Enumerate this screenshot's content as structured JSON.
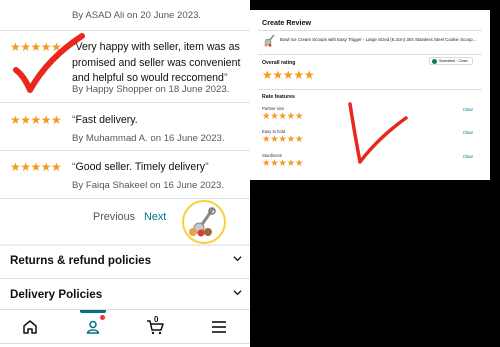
{
  "left": {
    "top_byline": "By ASAD Ali on 20 June 2023.",
    "reviews": [
      {
        "stars": "★★★★★",
        "text": "Very happy with seller, item was as promised and seller was convenient and helpful so would reccomend",
        "byline": "By Happy Shopper on 18 June 2023."
      },
      {
        "stars": "★★★★★",
        "text": "Fast delivery.",
        "byline": "By Muhammad A. on 16 June 2023."
      },
      {
        "stars": "★★★★★",
        "text": "Good seller. Timely delivery",
        "byline": "By Faiqa Shakeel on 16 June 2023."
      }
    ],
    "quote_open": "“",
    "quote_close": "”",
    "pager": {
      "previous": "Previous",
      "next": "Next"
    },
    "sections": [
      {
        "label": "Returns & refund policies"
      },
      {
        "label": "Delivery Policies"
      }
    ],
    "tabs": {
      "home_icon": "home-icon",
      "account_icon": "account-icon",
      "cart_icon": "cart-icon",
      "cart_count": "0",
      "menu_icon": "menu-icon"
    },
    "accent_color": "#007185",
    "star_color": "#f29b1d"
  },
  "right": {
    "title": "Create Review",
    "product_title": "Bowl Ice Cream Scoops with Easy Trigger - Large Sized (6.3cm) 304 Stainless Steel Cookie Scoop...",
    "overall_rating_label": "Overall rating",
    "overall_stars": "★★★★★",
    "submitted_label": "Submitted · Close",
    "rate_features_label": "Rate features",
    "features": [
      {
        "name": "Partner size",
        "stars": "★★★★★",
        "clear": "Clear"
      },
      {
        "name": "Easy to hold",
        "stars": "★★★★★",
        "clear": "Clear"
      },
      {
        "name": "Sturdiness",
        "stars": "★★★★★",
        "clear": "Clear"
      }
    ]
  },
  "annotation_color": "#e8281c"
}
